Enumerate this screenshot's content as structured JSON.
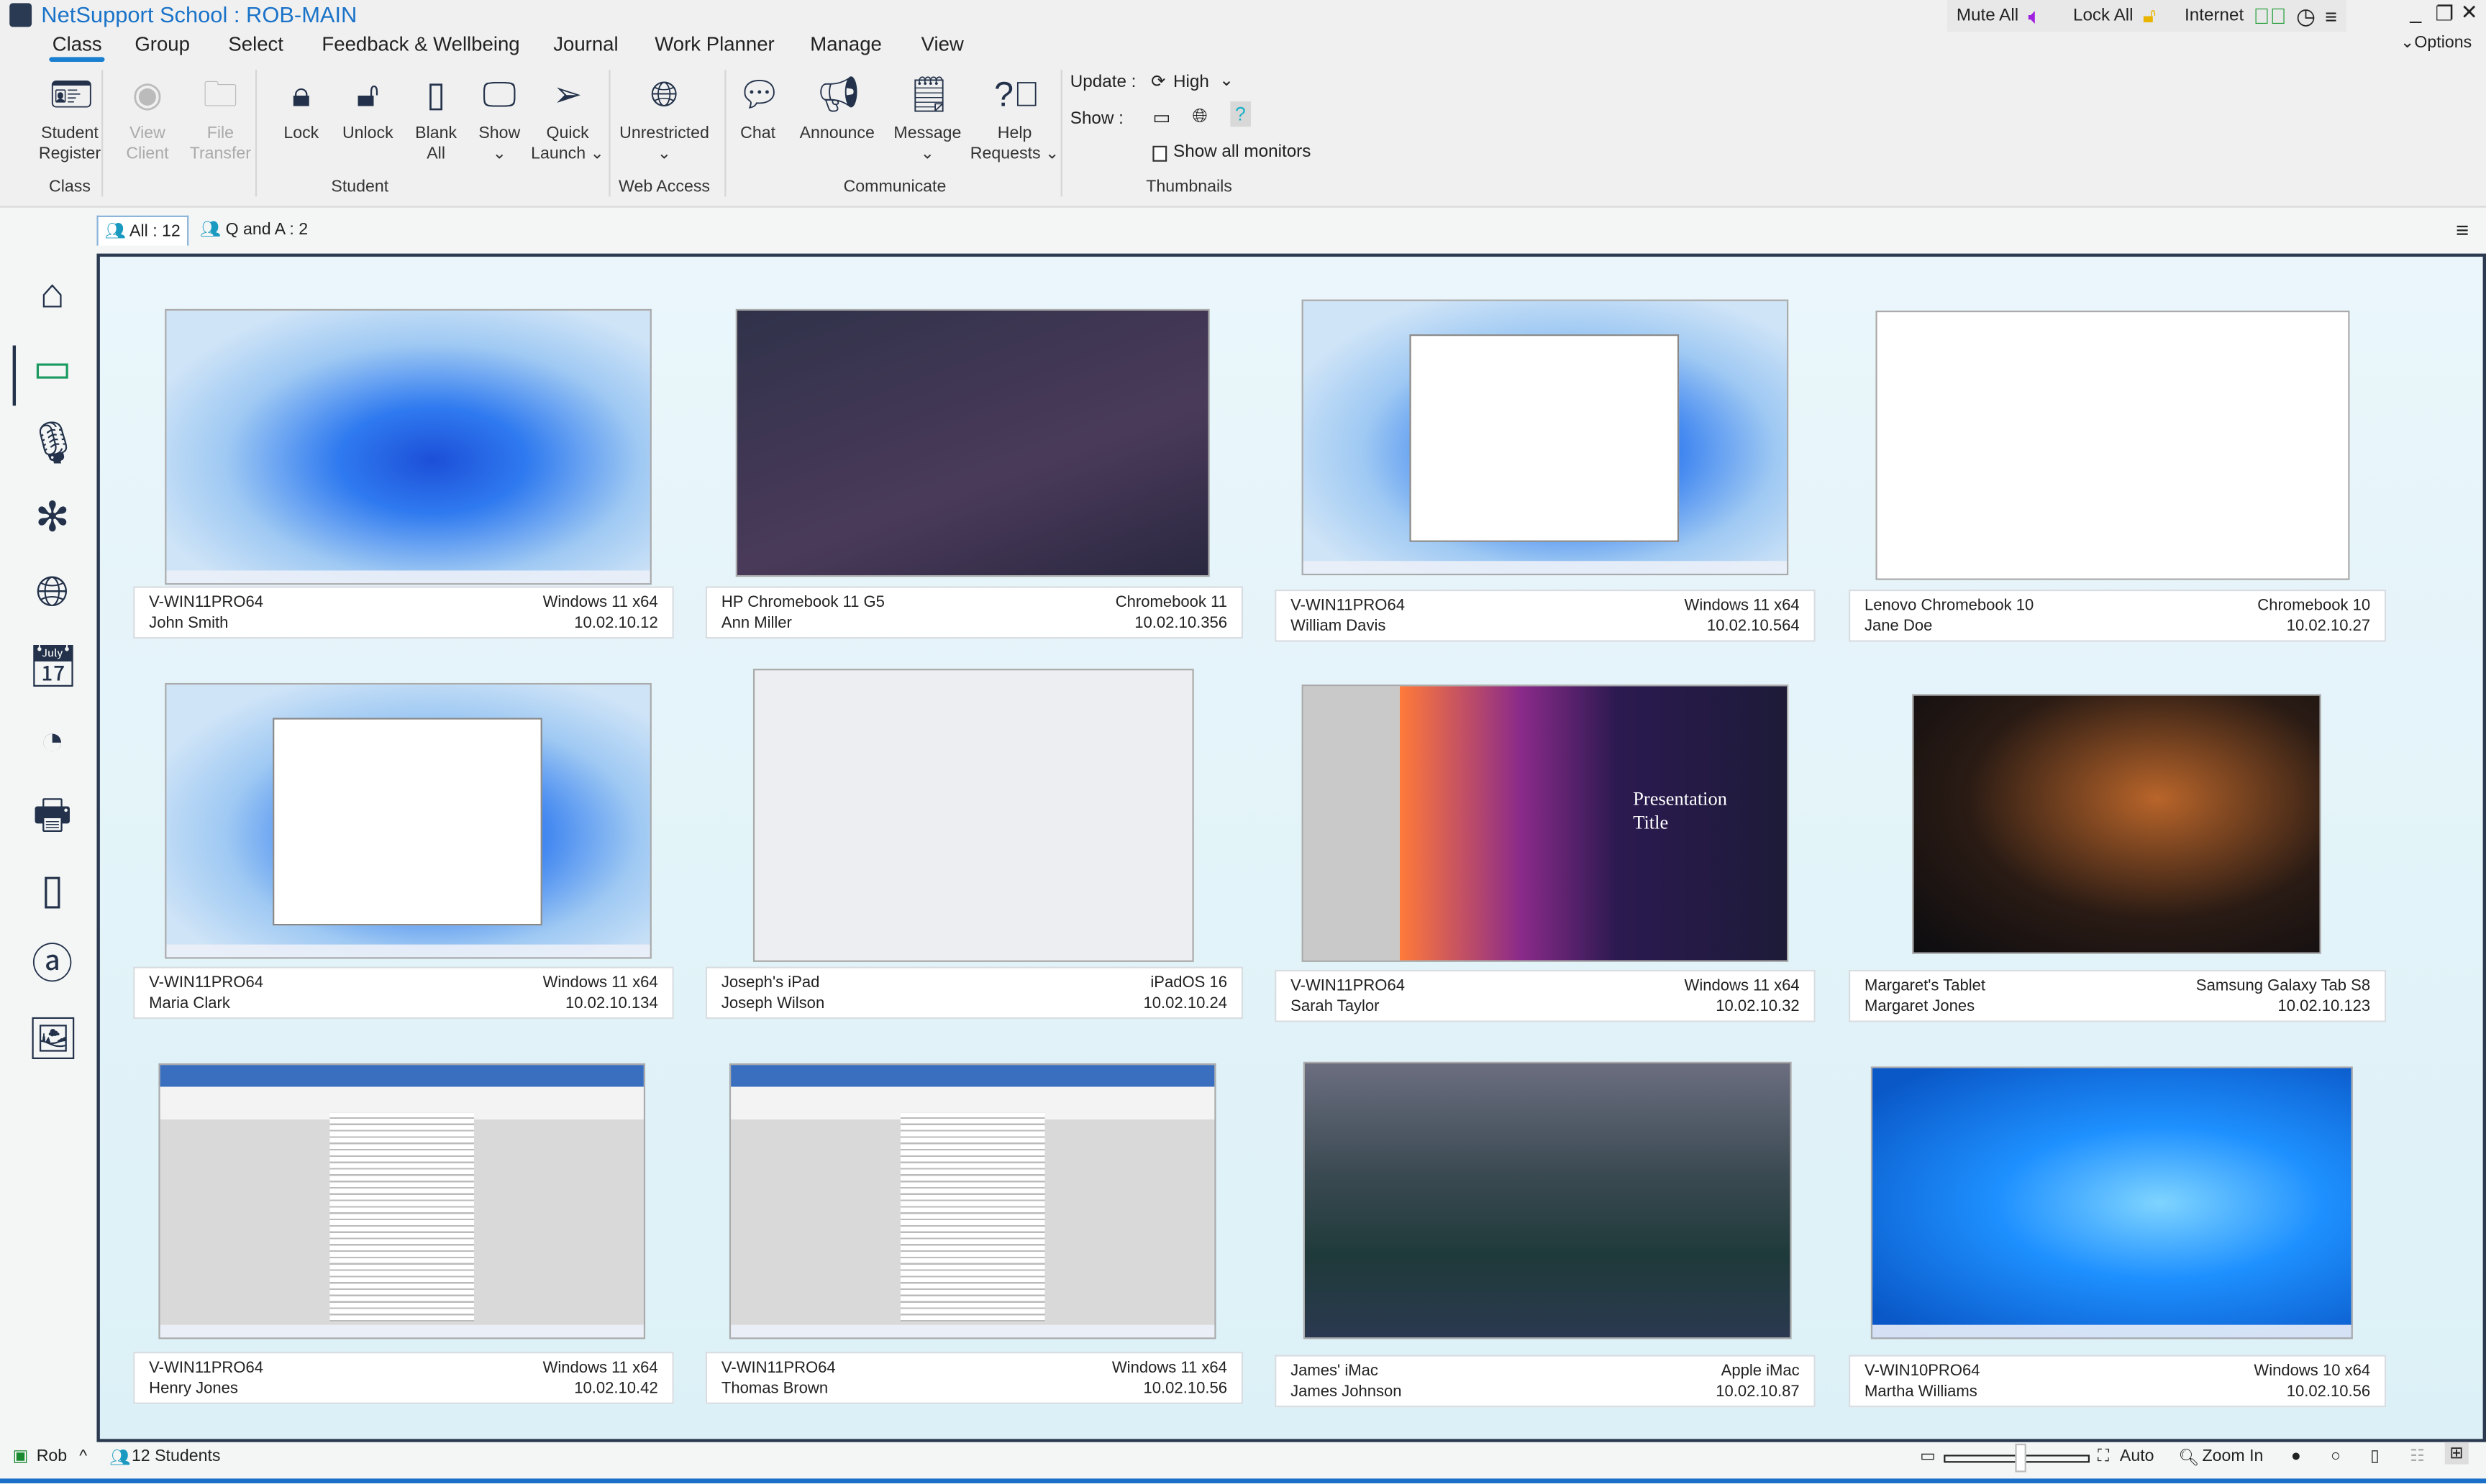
{
  "window": {
    "title": "NetSupport School : ROB-MAIN",
    "mute_all": "Mute All",
    "lock_all": "Lock All",
    "internet": "Internet",
    "options": "Options"
  },
  "menu": [
    "Class",
    "Group",
    "Select",
    "Feedback & Wellbeing",
    "Journal",
    "Work Planner",
    "Manage",
    "View"
  ],
  "ribbon": {
    "buttons": [
      {
        "label": "Student",
        "label2": "Register",
        "icon": "student-register-icon",
        "enabled": true
      },
      {
        "label": "View",
        "label2": "Client",
        "icon": "view-client-icon",
        "enabled": false
      },
      {
        "label": "File",
        "label2": "Transfer",
        "icon": "file-transfer-icon",
        "enabled": false
      },
      {
        "label": "Lock",
        "label2": "",
        "icon": "lock-icon",
        "enabled": true
      },
      {
        "label": "Unlock",
        "label2": "",
        "icon": "unlock-icon",
        "enabled": true
      },
      {
        "label": "Blank",
        "label2": "All",
        "icon": "blank-screen-icon",
        "enabled": true
      },
      {
        "label": "Show",
        "label2": "⌄",
        "icon": "show-icon",
        "enabled": true
      },
      {
        "label": "Quick",
        "label2": "Launch ⌄",
        "icon": "quick-launch-icon",
        "enabled": true
      },
      {
        "label": "Unrestricted",
        "label2": "⌄",
        "icon": "globe-icon",
        "enabled": true
      },
      {
        "label": "Chat",
        "label2": "",
        "icon": "chat-icon",
        "enabled": true
      },
      {
        "label": "Announce",
        "label2": "",
        "icon": "announce-icon",
        "enabled": true
      },
      {
        "label": "Message",
        "label2": "⌄",
        "icon": "message-icon",
        "enabled": true
      },
      {
        "label": "Help",
        "label2": "Requests ⌄",
        "icon": "help-requests-icon",
        "enabled": true
      }
    ],
    "groups": [
      "Class",
      "Student",
      "Web Access",
      "Communicate",
      "Thumbnails"
    ],
    "update_label": "Update :",
    "update_value": "High",
    "show_label": "Show :",
    "show_all_monitors": "Show all monitors",
    "show_all_monitors_checked": false
  },
  "tabs": [
    {
      "label": "All : 12",
      "active": true
    },
    {
      "label": "Q and A : 2",
      "active": false
    }
  ],
  "sidebar": [
    "home-icon",
    "monitor-icon",
    "microphone-icon",
    "wellbeing-icon",
    "globe-icon",
    "calendar-icon",
    "pie-chart-icon",
    "printer-icon",
    "device-icon",
    "at-sign-icon",
    "image-icon"
  ],
  "students": [
    {
      "machine": "V-WIN11PRO64",
      "os": "Windows 11 x64",
      "name": "John Smith",
      "ip": "10.02.10.12"
    },
    {
      "machine": "HP Chromebook 11 G5",
      "os": "Chromebook 11",
      "name": "Ann Miller",
      "ip": "10.02.10.356"
    },
    {
      "machine": "V-WIN11PRO64",
      "os": "Windows 11 x64",
      "name": "William Davis",
      "ip": "10.02.10.564"
    },
    {
      "machine": "Lenovo Chromebook 10",
      "os": "Chromebook 10",
      "name": "Jane Doe",
      "ip": "10.02.10.27"
    },
    {
      "machine": "V-WIN11PRO64",
      "os": "Windows 11 x64",
      "name": "Maria Clark",
      "ip": "10.02.10.134"
    },
    {
      "machine": "Joseph's iPad",
      "os": "iPadOS 16",
      "name": "Joseph Wilson",
      "ip": "10.02.10.24"
    },
    {
      "machine": "V-WIN11PRO64",
      "os": "Windows 11 x64",
      "name": "Sarah Taylor",
      "ip": "10.02.10.32"
    },
    {
      "machine": "Margaret's Tablet",
      "os": "Samsung Galaxy Tab S8",
      "name": "Margaret Jones",
      "ip": "10.02.10.123"
    },
    {
      "machine": "V-WIN11PRO64",
      "os": "Windows 11 x64",
      "name": "Henry Jones",
      "ip": "10.02.10.42"
    },
    {
      "machine": "V-WIN11PRO64",
      "os": "Windows 11 x64",
      "name": "Thomas Brown",
      "ip": "10.02.10.56"
    },
    {
      "machine": "James' iMac",
      "os": "Apple iMac",
      "name": "James Johnson",
      "ip": "10.02.10.87"
    },
    {
      "machine": "V-WIN10PRO64",
      "os": "Windows 10 x64",
      "name": "Martha Williams",
      "ip": "10.02.10.56"
    }
  ],
  "screen_content": {
    "presentation_title": "Presentation Title"
  },
  "status": {
    "user": "Rob",
    "students": "12 Students",
    "auto": "Auto",
    "zoom_in": "Zoom In"
  },
  "colors": {
    "accent": "#1a7fd0",
    "title": "#1a73c8",
    "dark_icon": "#23324a",
    "border": "#2b3a50"
  }
}
